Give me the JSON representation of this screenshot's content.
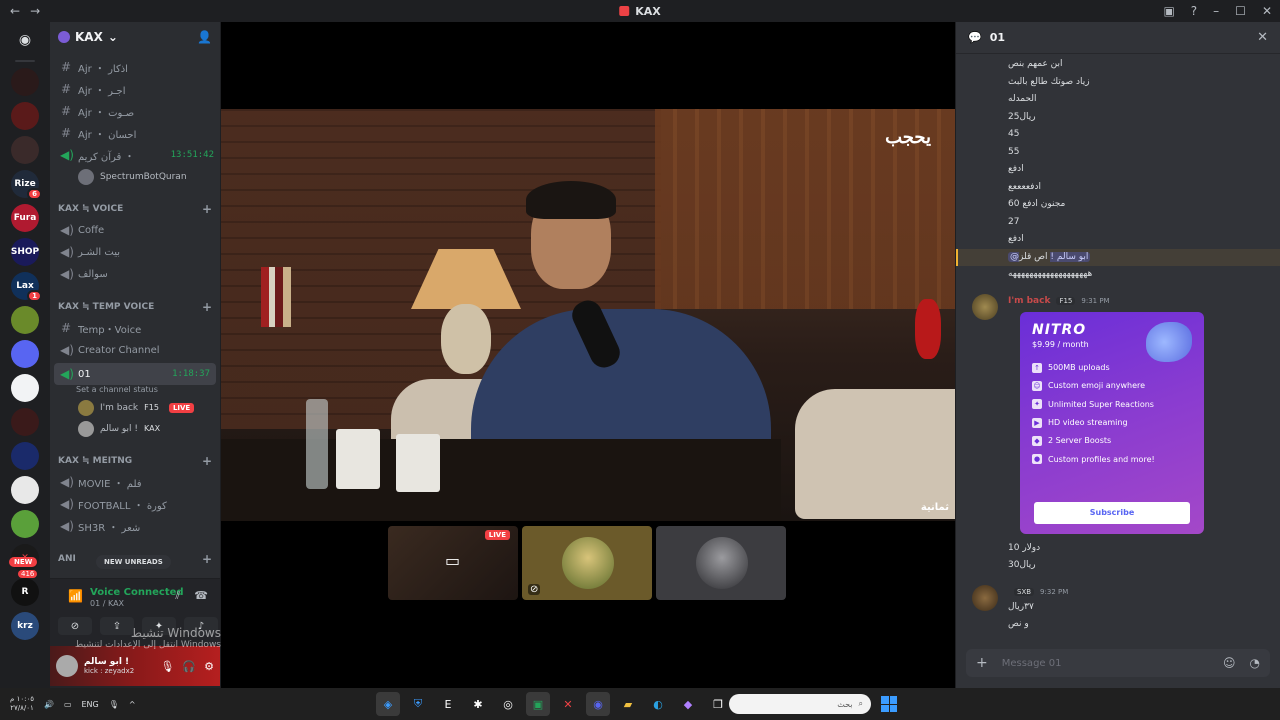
{
  "window": {
    "title": "KAX",
    "nav_back": "←",
    "nav_forward": "→"
  },
  "server_rail": {
    "items": [
      {
        "label": "",
        "badge": ""
      },
      {
        "label": "",
        "badge": ""
      },
      {
        "label": "",
        "badge": ""
      },
      {
        "label": "Rize",
        "badge": "6"
      },
      {
        "label": "Fura",
        "badge": ""
      },
      {
        "label": "SHOP",
        "badge": ""
      },
      {
        "label": "Lax",
        "badge": "1"
      },
      {
        "label": "",
        "badge": ""
      },
      {
        "label": "",
        "badge": ""
      },
      {
        "label": "",
        "badge": ""
      },
      {
        "label": "",
        "badge": ""
      },
      {
        "label": "",
        "badge": ""
      },
      {
        "label": "",
        "badge": ""
      },
      {
        "label": "",
        "badge": ""
      },
      {
        "label": "R",
        "badge": ""
      },
      {
        "label": "krz",
        "badge": ""
      }
    ],
    "new_pill": "NEW",
    "new_count": "416"
  },
  "guild": {
    "name": "KAX"
  },
  "channels": {
    "top": [
      {
        "icon": "#",
        "label": "Ajr ・ اذكار"
      },
      {
        "icon": "#",
        "label": "Ajr ・ اجـر"
      },
      {
        "icon": "#",
        "label": "Ajr ・ صـوت"
      },
      {
        "icon": "#",
        "label": "Ajr ・ احسان"
      },
      {
        "icon": "🔊",
        "label": "قرآن كريم ・",
        "time": "13:51:42"
      }
    ],
    "bot_member": "SpectrumBotQuran",
    "voice_category": "KAX ≒ VOICE",
    "voice": [
      {
        "icon": "🔈",
        "label": "Coffe"
      },
      {
        "icon": "🔈",
        "label": "بيت الشـر"
      },
      {
        "icon": "🔈",
        "label": "سوالف"
      }
    ],
    "temp_category": "KAX ≒ TEMP VOICE",
    "temp": [
      {
        "icon": "#",
        "label": "Temp・Voice"
      },
      {
        "icon": "🔈",
        "label": "Creator Channel"
      }
    ],
    "active_channel": {
      "label": "01",
      "time": "1:18:37",
      "status": "Set a channel status"
    },
    "active_members": [
      {
        "name": "I'm back",
        "tag": "F15",
        "live": "LIVE"
      },
      {
        "name": "ابو سالم !",
        "tag": "KAX",
        "live": ""
      }
    ],
    "meeting_category": "KAX ≒ MEITNG",
    "meeting": [
      {
        "icon": "🔈",
        "label": "MOVIE ・ فلم"
      },
      {
        "icon": "🔈",
        "label": "FOOTBALL ・ كورة"
      },
      {
        "icon": "🔈",
        "label": "SH3R ・ شعر"
      }
    ],
    "partial_category": "ANI",
    "new_unreads": "NEW UNREADS"
  },
  "voice_panel": {
    "title": "Voice Connected",
    "subtitle": "01 / KAX"
  },
  "user_panel": {
    "name": "ابو سالم !",
    "status": "kick : zeyadx2"
  },
  "windows_watermark": {
    "title": "تنشيط Windows",
    "subtitle": "انتقل إلى الإعدادات لتنشيط Windows"
  },
  "stage": {
    "brand_logo": "يحجب",
    "brand_logo_small": "ثمانية",
    "tiles": [
      {
        "live": "LIVE"
      },
      {
        "live": ""
      },
      {
        "live": ""
      }
    ]
  },
  "chat": {
    "channel_name": "01",
    "lines_top": [
      "ابن عمهم بنص",
      "زياد صوتك طالع بالبث",
      "الحمدله",
      "25ريال",
      "45",
      "55",
      "ادفع",
      "ادفععععع",
      "مجنون ادفع 60",
      "27",
      "ادفع"
    ],
    "mention_line": {
      "mention": "@ابو سالم !",
      "text": "اص قلز"
    },
    "laugh_line": "هههههههههههههههههههه",
    "msg1": {
      "author": "I'm back",
      "tag": "F15",
      "time": "9:31 PM"
    },
    "nitro": {
      "logo": "NITRO",
      "price": "$9.99 / month",
      "features": [
        "500MB uploads",
        "Custom emoji anywhere",
        "Unlimited Super Reactions",
        "HD video streaming",
        "2 Server Boosts",
        "Custom profiles and more!"
      ],
      "subscribe": "Subscribe"
    },
    "after_nitro": [
      "10 دولار",
      "30ريال"
    ],
    "msg2": {
      "author": "",
      "tag": "SXB",
      "time": "9:32 PM"
    },
    "msg2_lines": [
      "٣٧ريال",
      "و نص"
    ],
    "input_placeholder": "Message 01"
  },
  "taskbar": {
    "time": "١٠:٠٥ م",
    "date": "٢٧/٨/٠١",
    "lang": "ENG",
    "search_placeholder": "بحث"
  }
}
